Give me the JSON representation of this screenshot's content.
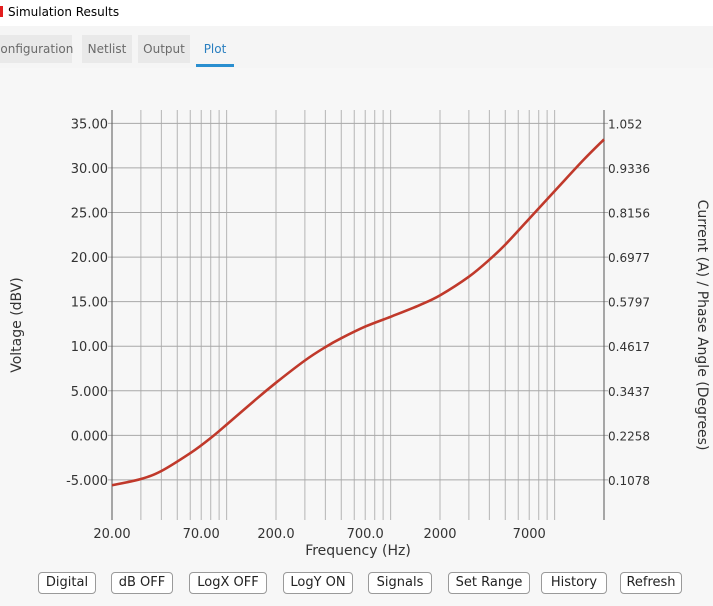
{
  "window": {
    "title": "Simulation Results"
  },
  "tabs": [
    "Configuration",
    "Netlist",
    "Output",
    "Plot"
  ],
  "active_tab": "Plot",
  "toolbar": {
    "digital": "Digital",
    "db": "dB OFF",
    "logx": "LogX OFF",
    "logy": "LogY ON",
    "signals": "Signals",
    "set_range": "Set Range",
    "history": "History",
    "refresh": "Refresh"
  },
  "colors": {
    "accent": "#2a8fd0",
    "trace": "#c0392b"
  },
  "chart_data": {
    "type": "line",
    "xlabel": "Frequency (Hz)",
    "ylabel": "Voltage (dBV)",
    "y2label": "Current (A) / Phase Angle (Degrees)",
    "xscale": "log",
    "xlim": [
      20,
      20000
    ],
    "ylim": [
      -9.5,
      36.5
    ],
    "xtick_labels": [
      "20.00",
      "70.00",
      "200.0",
      "700.0",
      "2000",
      "7000"
    ],
    "xtick_values": [
      20,
      70,
      200,
      700,
      2000,
      7000
    ],
    "ytick_labels": [
      "35.00",
      "30.00",
      "25.00",
      "20.00",
      "15.00",
      "10.00",
      "5.000",
      "0.000",
      "-5.000"
    ],
    "ytick_values": [
      35,
      30,
      25,
      20,
      15,
      10,
      5,
      0,
      -5
    ],
    "y2tick_labels": [
      "1.052",
      "0.9336",
      "0.8156",
      "0.6977",
      "0.5797",
      "0.4617",
      "0.3437",
      "0.2258",
      "0.1078"
    ],
    "grid": true,
    "series": [
      {
        "x": [
          20,
          30,
          40,
          60,
          80,
          100,
          150,
          200,
          300,
          400,
          500,
          700,
          1000,
          1500,
          2000,
          3000,
          4000,
          5000,
          7000,
          10000,
          15000,
          20000
        ],
        "y": [
          -5.6,
          -4.9,
          -4.0,
          -2.0,
          -0.3,
          1.2,
          4.0,
          5.9,
          8.4,
          9.9,
          10.9,
          12.2,
          13.3,
          14.6,
          15.7,
          17.8,
          19.7,
          21.4,
          24.3,
          27.4,
          30.9,
          33.2
        ]
      }
    ]
  }
}
